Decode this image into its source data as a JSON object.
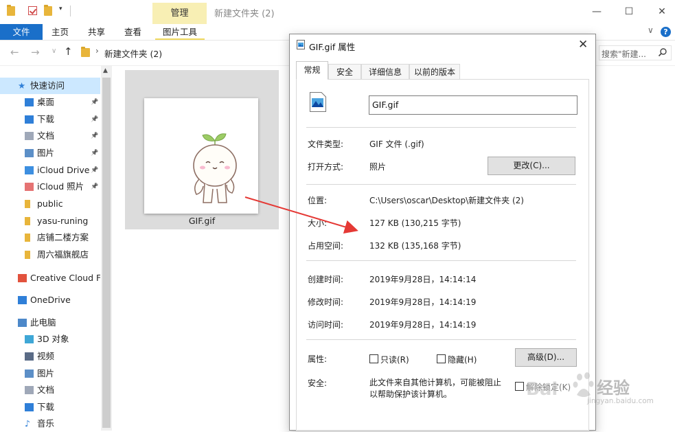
{
  "window": {
    "title": "新建文件夹 (2)",
    "context_tab": "管理",
    "controls": [
      "—",
      "☐",
      "✕"
    ]
  },
  "ribbon": {
    "tabs": [
      "文件",
      "主页",
      "共享",
      "查看",
      "图片工具"
    ],
    "collapse": "∨",
    "help": "?"
  },
  "address": {
    "path": "新建文件夹 (2)",
    "search_placeholder": "搜索\"新建...",
    "nav": [
      "←",
      "→",
      "∨",
      "↑"
    ]
  },
  "sidebar": {
    "items": [
      {
        "label": "快速访问",
        "icon": "star-icon",
        "pinned": false,
        "selected": true
      },
      {
        "label": "桌面",
        "icon": "desktop-icon",
        "pinned": true
      },
      {
        "label": "下载",
        "icon": "download-icon",
        "pinned": true
      },
      {
        "label": "文档",
        "icon": "document-icon",
        "pinned": true
      },
      {
        "label": "图片",
        "icon": "pictures-icon",
        "pinned": true
      },
      {
        "label": "iCloud Drive",
        "icon": "icloud-icon",
        "pinned": true
      },
      {
        "label": "iCloud 照片",
        "icon": "icloud-photos-icon",
        "pinned": true
      },
      {
        "label": "public",
        "icon": "folder-icon",
        "pinned": false
      },
      {
        "label": "yasu-runing",
        "icon": "folder-icon",
        "pinned": false
      },
      {
        "label": "店铺二楼方案",
        "icon": "folder-icon",
        "pinned": false
      },
      {
        "label": "周六福旗舰店",
        "icon": "folder-icon",
        "pinned": false
      },
      {
        "label": "Creative Cloud F",
        "icon": "creative-cloud-icon",
        "pinned": false
      },
      {
        "label": "OneDrive",
        "icon": "onedrive-icon",
        "pinned": false
      },
      {
        "label": "此电脑",
        "icon": "this-pc-icon",
        "pinned": false
      },
      {
        "label": "3D 对象",
        "icon": "3d-objects-icon",
        "pinned": false
      },
      {
        "label": "视频",
        "icon": "video-icon",
        "pinned": false
      },
      {
        "label": "图片",
        "icon": "pictures-icon",
        "pinned": false
      },
      {
        "label": "文档",
        "icon": "document-icon",
        "pinned": false
      },
      {
        "label": "下载",
        "icon": "download-icon",
        "pinned": false
      },
      {
        "label": "音乐",
        "icon": "music-icon",
        "pinned": false
      }
    ]
  },
  "content": {
    "file_name": "GIF.gif"
  },
  "dialog": {
    "title": "GIF.gif 属性",
    "tabs": [
      "常规",
      "安全",
      "详细信息",
      "以前的版本"
    ],
    "file_name": "GIF.gif",
    "rows": {
      "type_label": "文件类型:",
      "type_value": "GIF 文件 (.gif)",
      "open_label": "打开方式:",
      "open_value": "照片",
      "change_button": "更改(C)...",
      "location_label": "位置:",
      "location_value": "C:\\Users\\oscar\\Desktop\\新建文件夹 (2)",
      "size_label": "大小:",
      "size_value": "127 KB (130,215 字节)",
      "disk_label": "占用空间:",
      "disk_value": "132 KB (135,168 字节)",
      "created_label": "创建时间:",
      "created_value": "2019年9月28日，14:14:14",
      "modified_label": "修改时间:",
      "modified_value": "2019年9月28日，14:14:19",
      "accessed_label": "访问时间:",
      "accessed_value": "2019年9月28日，14:14:19",
      "attr_label": "属性:",
      "readonly": "只读(R)",
      "hidden": "隐藏(H)",
      "advanced_button": "高级(D)...",
      "security_label": "安全:",
      "security_text_1": "此文件来自其他计算机，可能被阻止",
      "security_text_2": "以帮助保护该计算机。",
      "unblock": "解除锁定(K)"
    }
  },
  "watermark": {
    "brand": "Bai",
    "text": "经验",
    "url": "jingyan.baidu.com"
  },
  "colors": {
    "accent": "#1a6fc9",
    "manage_tab": "#f8efb4",
    "selection": "#cce8ff",
    "arrow": "#e53935"
  }
}
